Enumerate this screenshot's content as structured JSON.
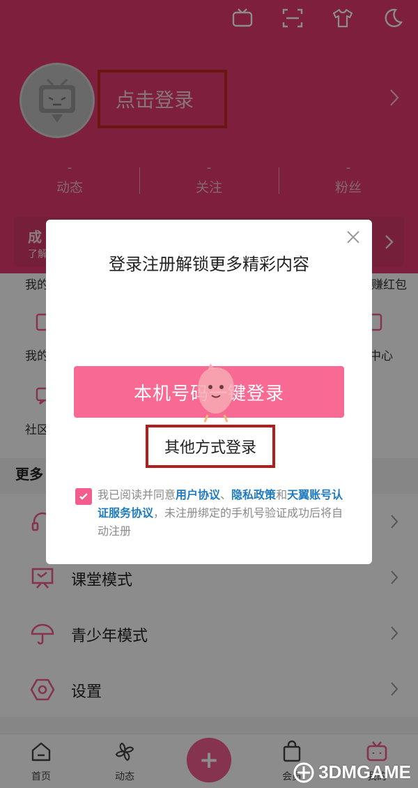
{
  "header": {
    "login_text": "点击登录",
    "stats": [
      {
        "value": "-",
        "label": "动态"
      },
      {
        "value": "-",
        "label": "关注"
      },
      {
        "value": "-",
        "label": "粉丝"
      }
    ],
    "icons": [
      "tv-icon",
      "scan-icon",
      "shirt-icon",
      "moon-icon"
    ],
    "accent": "#e33a6f"
  },
  "banner": {
    "title": "成",
    "subtitle": "了解"
  },
  "grid": {
    "left_labels": [
      "我的",
      "我的",
      "社区"
    ],
    "right_labels": [
      "赚红包",
      "中心"
    ]
  },
  "more_title": "更多",
  "menu": [
    {
      "label": "",
      "icon": "headset-icon"
    },
    {
      "label": "课堂模式",
      "icon": "classroom-icon"
    },
    {
      "label": "青少年模式",
      "icon": "umbrella-icon"
    },
    {
      "label": "设置",
      "icon": "settings-icon"
    }
  ],
  "tabbar": {
    "tabs": [
      {
        "label": "首页",
        "icon": "home-icon"
      },
      {
        "label": "动态",
        "icon": "pinwheel-icon"
      },
      {
        "label": "会员",
        "icon": "shopping-bag-icon"
      },
      {
        "label": "我的",
        "icon": "tv-icon"
      }
    ],
    "publish_symbol": "+"
  },
  "modal": {
    "title": "登录注册解锁更多精彩内容",
    "one_click_button": "本机号码一键登录",
    "other_login_button": "其他方式登录",
    "agreement": {
      "prefix": "我已阅读并同意",
      "link1": "用户协议",
      "sep1": "、",
      "link2": "隐私政策",
      "sep2": "和",
      "link3": "天翼账号认证服务协议",
      "suffix": "，未注册绑定的手机号验证成功后将自动注册",
      "checked": true
    },
    "brand_color": "#f86a93"
  },
  "watermark": "3DMGAME"
}
